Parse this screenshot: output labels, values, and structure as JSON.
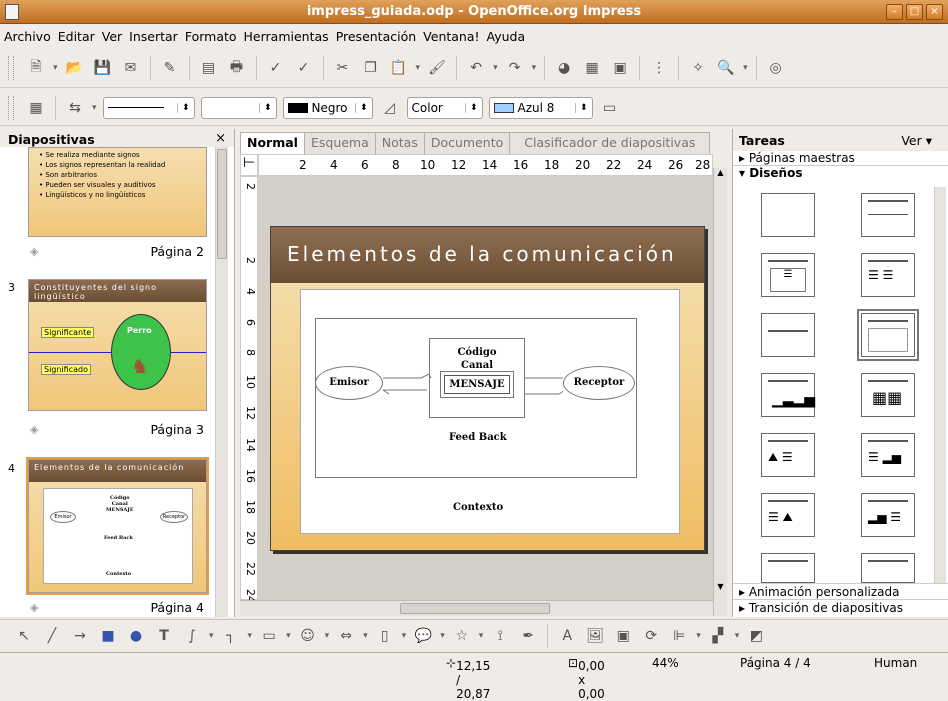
{
  "window": {
    "title": "impress_guiada.odp - OpenOffice.org Impress"
  },
  "menu": [
    "Archivo",
    "Editar",
    "Ver",
    "Insertar",
    "Formato",
    "Herramientas",
    "Presentación",
    "Ventana!",
    "Ayuda"
  ],
  "format_bar": {
    "line_color": "Negro",
    "area_style": "Color",
    "area_color": "Azul 8"
  },
  "slides_panel": {
    "title": "Diapositivas",
    "slide2_bullets": [
      "Se realiza mediante signos",
      "Los signos representan la realidad",
      "Son arbitrarios",
      "Pueden ser visuales y auditivos",
      "Lingüísticos y no lingüísticos"
    ],
    "slide2_label": "Página 2",
    "slide3_num": "3",
    "slide3_title": "Constituyentes del signo lingüístico",
    "slide3_significante": "Significante",
    "slide3_perro": "Perro",
    "slide3_significado": "Significado",
    "slide3_label": "Página 3",
    "slide4_num": "4",
    "slide4_title": "Elementos de la comunicación",
    "slide4_label": "Página 4"
  },
  "tabs": [
    "Normal",
    "Esquema",
    "Notas",
    "Documento",
    "Clasificador de diapositivas"
  ],
  "ruler_h": [
    "2",
    "4",
    "6",
    "8",
    "10",
    "12",
    "14",
    "16",
    "18",
    "20",
    "22",
    "24",
    "26",
    "28"
  ],
  "ruler_v": [
    "2",
    "2",
    "4",
    "6",
    "8",
    "10",
    "12",
    "14",
    "16",
    "18",
    "20",
    "22",
    "24"
  ],
  "slide": {
    "title": "Elementos de la comunicación",
    "codigo": "Código",
    "canal": "Canal",
    "mensaje": "MENSAJE",
    "emisor": "Emisor",
    "receptor": "Receptor",
    "feedback": "Feed Back",
    "contexto": "Contexto"
  },
  "tasks": {
    "title": "Tareas",
    "view": "Ver",
    "master_pages": "Páginas maestras",
    "layouts": "Diseños",
    "custom_animation": "Animación personalizada",
    "slide_transition": "Transición de diapositivas"
  },
  "status": {
    "position": "12,15 / 20,87",
    "size": "0,00 x 0,00",
    "zoom": "44%",
    "page": "Página 4 / 4",
    "master": "Human"
  }
}
